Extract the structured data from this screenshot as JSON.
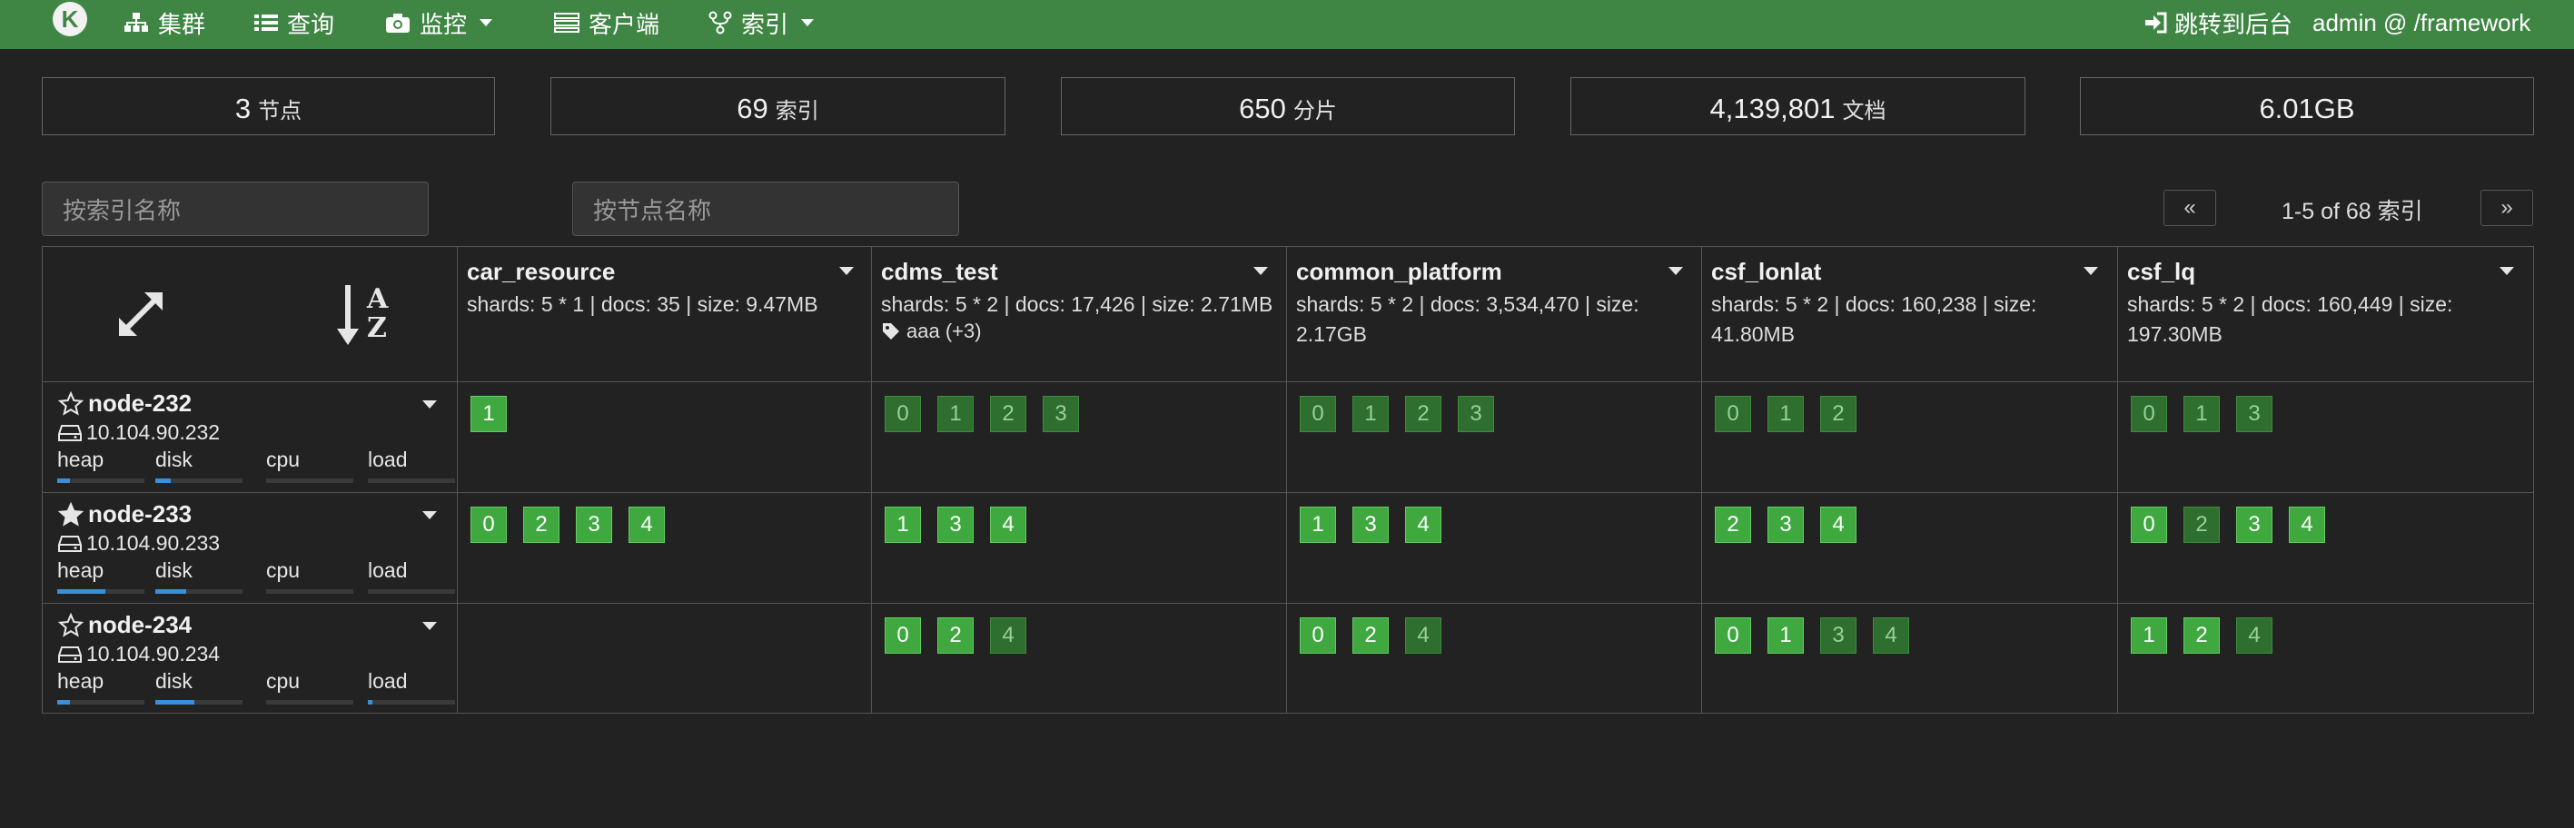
{
  "navbar": {
    "logo": "K",
    "items": [
      {
        "label": "集群",
        "icon": "sitemap-icon",
        "dropdown": false
      },
      {
        "label": "查询",
        "icon": "list-icon",
        "dropdown": false
      },
      {
        "label": "监控",
        "icon": "camera-icon",
        "dropdown": true
      },
      {
        "label": "客户端",
        "icon": "server-icon",
        "dropdown": false
      },
      {
        "label": "索引",
        "icon": "fork-icon",
        "dropdown": true
      }
    ],
    "backend_link": "跳转到后台",
    "user": "admin @ /framework"
  },
  "stats": [
    {
      "value": "3",
      "unit": "节点"
    },
    {
      "value": "69",
      "unit": "索引"
    },
    {
      "value": "650",
      "unit": "分片"
    },
    {
      "value": "4,139,801",
      "unit": "文档"
    },
    {
      "value": "6.01GB",
      "unit": ""
    }
  ],
  "filters": {
    "index_placeholder": "按索引名称",
    "node_placeholder": "按节点名称"
  },
  "pager": {
    "prev": "«",
    "next": "»",
    "text": "1-5 of 68 索引"
  },
  "indices": [
    {
      "name": "car_resource",
      "meta": "shards: 5 * 1 | docs: 35 | size: 9.47MB",
      "tag": ""
    },
    {
      "name": "cdms_test",
      "meta": "shards: 5 * 2 | docs: 17,426 | size: 2.71MB",
      "tag": "aaa (+3)"
    },
    {
      "name": "common_platform",
      "meta": "shards: 5 * 2 | docs: 3,534,470 | size: 2.17GB",
      "tag": ""
    },
    {
      "name": "csf_lonlat",
      "meta": "shards: 5 * 2 | docs: 160,238 | size: 41.80MB",
      "tag": ""
    },
    {
      "name": "csf_lq",
      "meta": "shards: 5 * 2 | docs: 160,449 | size: 197.30MB",
      "tag": ""
    }
  ],
  "nodes": [
    {
      "name": "node-232",
      "master": false,
      "ip": "10.104.90.232",
      "metrics": {
        "heap": 0.15,
        "disk": 0.18,
        "cpu": 0.0,
        "load": 0.0
      },
      "metric_labels": [
        "heap",
        "disk",
        "cpu",
        "load"
      ],
      "shards": [
        [
          {
            "n": "1",
            "p": true
          }
        ],
        [
          {
            "n": "0",
            "p": false
          },
          {
            "n": "1",
            "p": false
          },
          {
            "n": "2",
            "p": false
          },
          {
            "n": "3",
            "p": false
          }
        ],
        [
          {
            "n": "0",
            "p": false
          },
          {
            "n": "1",
            "p": false
          },
          {
            "n": "2",
            "p": false
          },
          {
            "n": "3",
            "p": false
          }
        ],
        [
          {
            "n": "0",
            "p": false
          },
          {
            "n": "1",
            "p": false
          },
          {
            "n": "2",
            "p": false
          }
        ],
        [
          {
            "n": "0",
            "p": false
          },
          {
            "n": "1",
            "p": false
          },
          {
            "n": "3",
            "p": false
          }
        ]
      ]
    },
    {
      "name": "node-233",
      "master": true,
      "ip": "10.104.90.233",
      "metrics": {
        "heap": 0.55,
        "disk": 0.35,
        "cpu": 0.0,
        "load": 0.0
      },
      "metric_labels": [
        "heap",
        "disk",
        "cpu",
        "load"
      ],
      "shards": [
        [
          {
            "n": "0",
            "p": true
          },
          {
            "n": "2",
            "p": true
          },
          {
            "n": "3",
            "p": true
          },
          {
            "n": "4",
            "p": true
          }
        ],
        [
          {
            "n": "1",
            "p": true
          },
          {
            "n": "3",
            "p": true
          },
          {
            "n": "4",
            "p": true
          }
        ],
        [
          {
            "n": "1",
            "p": true
          },
          {
            "n": "3",
            "p": true
          },
          {
            "n": "4",
            "p": true
          }
        ],
        [
          {
            "n": "2",
            "p": true
          },
          {
            "n": "3",
            "p": true
          },
          {
            "n": "4",
            "p": true
          }
        ],
        [
          {
            "n": "0",
            "p": true
          },
          {
            "n": "2",
            "p": false
          },
          {
            "n": "3",
            "p": true
          },
          {
            "n": "4",
            "p": true
          }
        ]
      ]
    },
    {
      "name": "node-234",
      "master": false,
      "ip": "10.104.90.234",
      "metrics": {
        "heap": 0.15,
        "disk": 0.45,
        "cpu": 0.0,
        "load": 0.05
      },
      "metric_labels": [
        "heap",
        "disk",
        "cpu",
        "load"
      ],
      "shards": [
        [],
        [
          {
            "n": "0",
            "p": true
          },
          {
            "n": "2",
            "p": true
          },
          {
            "n": "4",
            "p": false
          }
        ],
        [
          {
            "n": "0",
            "p": true
          },
          {
            "n": "2",
            "p": true
          },
          {
            "n": "4",
            "p": false
          }
        ],
        [
          {
            "n": "0",
            "p": true
          },
          {
            "n": "1",
            "p": true
          },
          {
            "n": "3",
            "p": false
          },
          {
            "n": "4",
            "p": false
          }
        ],
        [
          {
            "n": "1",
            "p": true
          },
          {
            "n": "2",
            "p": true
          },
          {
            "n": "4",
            "p": false
          }
        ]
      ]
    }
  ],
  "corner": {
    "expand_icon": "expand-icon",
    "sort_icon": "sort-alpha-icon",
    "sort_top": "A",
    "sort_bottom": "Z"
  },
  "colors": {
    "navbar": "#3f8644",
    "primary_shard": "#3fa83f",
    "replica_shard": "#2e6e2e",
    "metric_bar": "#3b8fd9"
  }
}
